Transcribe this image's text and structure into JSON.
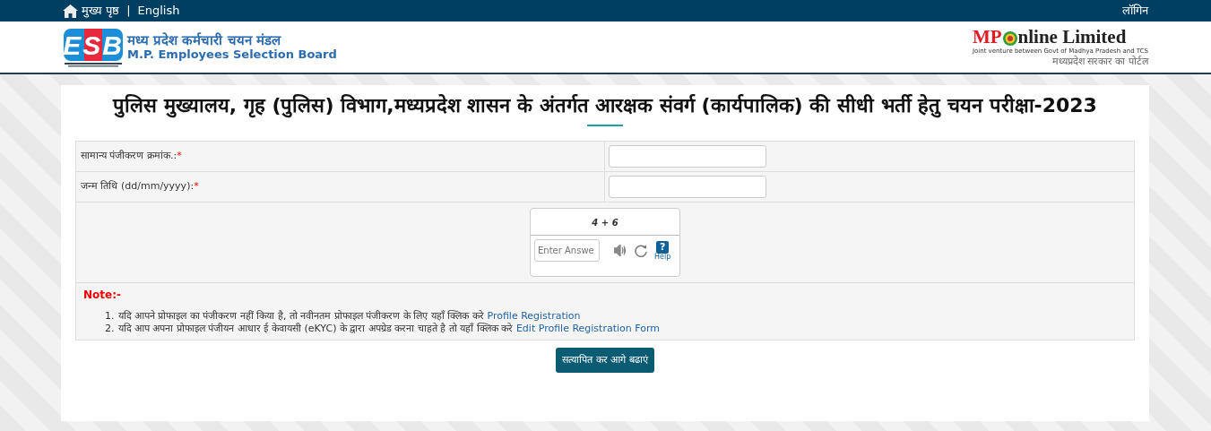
{
  "top_bar": {
    "home_link": "मुख्य पृष्ठ",
    "separator": "|",
    "language_link": "English",
    "login_link": "लॉगिन"
  },
  "header": {
    "esb_logo": {
      "letters": "ESB",
      "name_hindi": "मध्य प्रदेश कर्मचारी चयन मंडल",
      "name_english": "M.P. Employees Selection Board"
    },
    "mponline_logo": {
      "prefix": "MP",
      "suffix": "nline Limited",
      "subline": "Joint venture between Govt of Madhya Pradesh and TCS",
      "tagline": "मध्यप्रदेश सरकार का पोर्टल"
    }
  },
  "page_title": "पुलिस मुख्यालय, गृह (पुलिस) विभाग,मध्यप्रदेश शासन के अंतर्गत आरक्षक संवर्ग (कार्यपालिक) की सीधी भर्ती हेतु चयन परीक्षा-2023",
  "form": {
    "fields": [
      {
        "label": "सामान्य पंजीकरण क्रमांक.:",
        "required_mark": "*"
      },
      {
        "label": "जन्म तिथि (dd/mm/yyyy):",
        "required_mark": "*"
      }
    ],
    "captcha": {
      "expression": "4 + 6",
      "answer_placeholder": "Enter Answe",
      "help_label": "Help",
      "help_glyph": "?"
    },
    "note": {
      "heading": "Note:-",
      "items": [
        {
          "number": "1.",
          "text": "यदि आपने प्रोफाइल का पंजीकरण नहीं किया है, तो नवीनतम प्रोफाइल पंजीकरण के लिए यहाँ क्लिक करे",
          "link": "Profile Registration"
        },
        {
          "number": "2.",
          "text": "यदि आप अपना प्रोफाइल पंजीयन आधार ई केवायसी (eKYC) के द्वारा अपग्रेड करना चाहते है तो यहाँ क्लिक करे",
          "link": "Edit Profile Registration Form"
        }
      ]
    },
    "submit_button": "सत्यापित कर आगे बढाएं"
  }
}
